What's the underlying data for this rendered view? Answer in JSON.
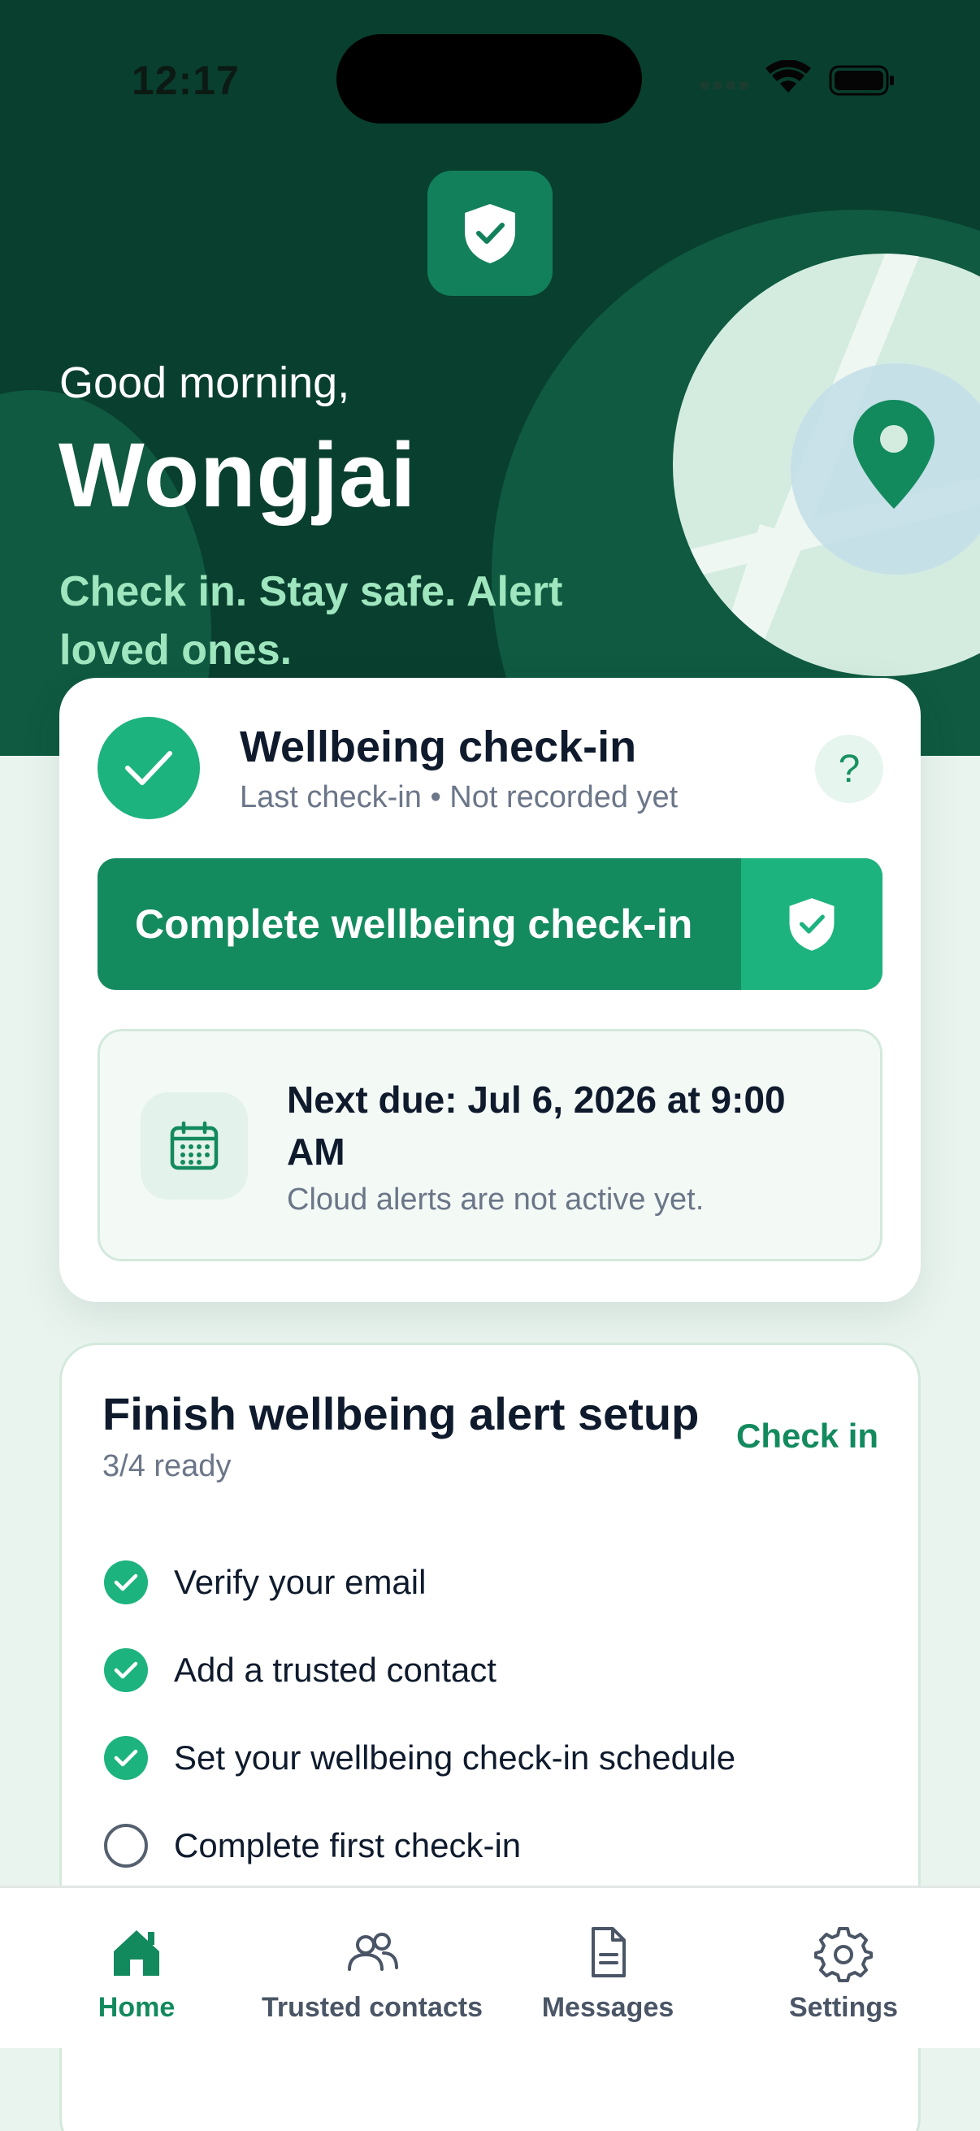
{
  "status_bar": {
    "time": "12:17"
  },
  "hero": {
    "greeting": "Good morning,",
    "name": "Wongjai",
    "tagline": "Check in. Stay safe. Alert loved ones."
  },
  "checkin_card": {
    "title": "Wellbeing check-in",
    "subtitle": "Last check-in • Not recorded yet",
    "help_label": "?",
    "primary_button": "Complete wellbeing check-in",
    "next_due": "Next due: Jul 6, 2026 at 9:00 AM",
    "alert_status": "Cloud alerts are not active yet."
  },
  "setup_card": {
    "title": "Finish wellbeing alert setup",
    "progress": "3/4 ready",
    "action_link": "Check in",
    "tasks": [
      {
        "label": "Verify your email",
        "done": true
      },
      {
        "label": "Add a trusted contact",
        "done": true
      },
      {
        "label": "Set your wellbeing check-in schedule",
        "done": true
      },
      {
        "label": "Complete first check-in",
        "done": false
      }
    ]
  },
  "tabs": [
    {
      "label": "Home",
      "icon": "home-icon",
      "active": true
    },
    {
      "label": "Trusted contacts",
      "icon": "people-icon",
      "active": false
    },
    {
      "label": "Messages",
      "icon": "document-icon",
      "active": false
    },
    {
      "label": "Settings",
      "icon": "gear-icon",
      "active": false
    }
  ],
  "colors": {
    "hero_bg": "#093f2f",
    "accent": "#1db37e",
    "primary": "#148b5f",
    "tagline": "#9fe6bf"
  }
}
